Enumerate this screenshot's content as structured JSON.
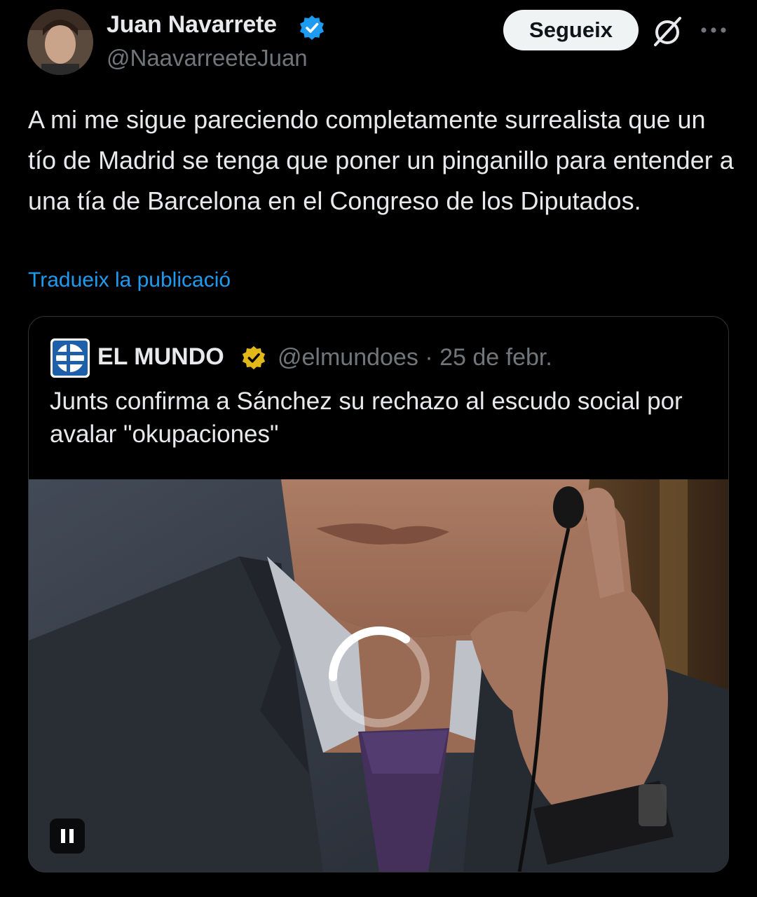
{
  "author": {
    "name": "Juan Navarrete",
    "handle": "@NaavarreeteJuan"
  },
  "actions": {
    "follow_label": "Segueix"
  },
  "tweet": {
    "text": "A mi me sigue pareciendo completamente surrealista que un tío de Madrid se tenga que poner un pinganillo para entender a una tía de Barcelona en el Congreso de los Diputados.",
    "translate_label": "Tradueix la publicació"
  },
  "quote": {
    "name": "EL MUNDO",
    "handle": "@elmundoes",
    "separator": "·",
    "date": "25 de febr.",
    "text": "Junts confirma a Sánchez su rechazo al escudo social por avalar \"okupaciones\""
  },
  "colors": {
    "background": "#000000",
    "text": "#e7e9ea",
    "muted": "#71767b",
    "link": "#1d9bf0",
    "verified_blue": "#1d9bf0",
    "verified_gold": "#e2b719"
  },
  "icons": [
    "verified-badge-icon",
    "grok-icon",
    "more-options-icon",
    "el-mundo-logo",
    "verified-gold-badge-icon",
    "loading-spinner-icon",
    "pause-icon"
  ]
}
